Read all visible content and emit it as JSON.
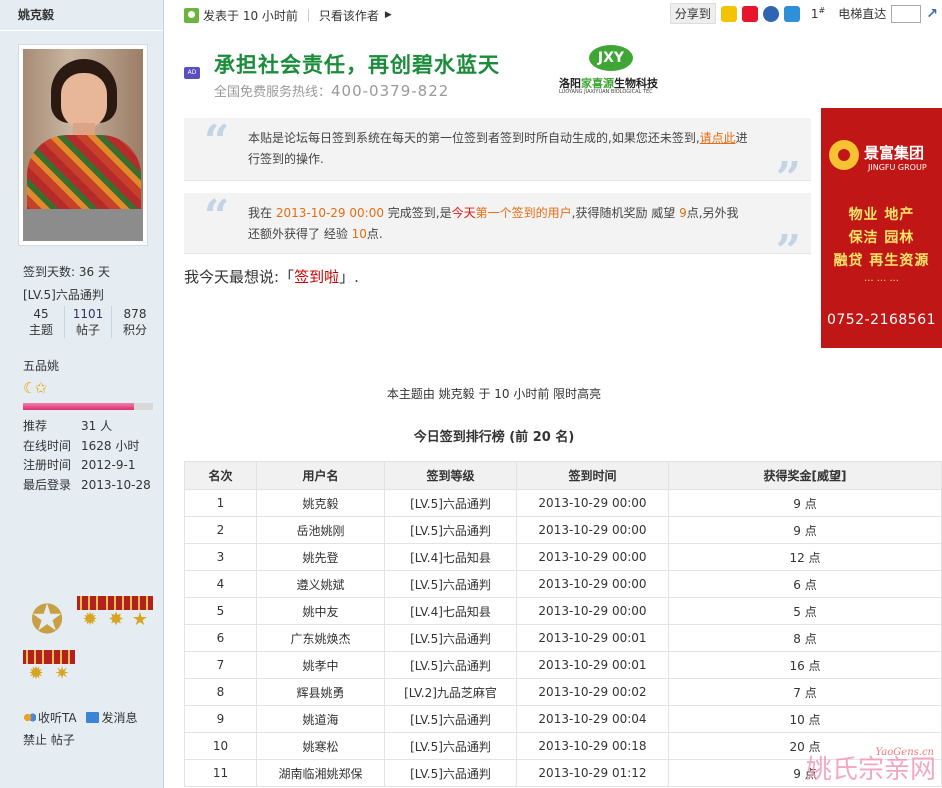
{
  "sidebar": {
    "username": "姚克毅",
    "signin_days": "签到天数: 36 天",
    "level": "[LV.5]六品通判",
    "counts": [
      {
        "num": "45",
        "label": "主题"
      },
      {
        "num": "1101",
        "label": "帖子"
      },
      {
        "num": "878",
        "label": "积分"
      }
    ],
    "rank_name": "五品姚",
    "rank_progress": 0.85,
    "info": [
      {
        "k": "推荐",
        "v": "31 人"
      },
      {
        "k": "在线时间",
        "v": "1628 小时"
      },
      {
        "k": "注册时间",
        "v": "2012-9-1"
      },
      {
        "k": "最后登录",
        "v": "2013-10-28"
      }
    ],
    "follow": "收听TA",
    "message": "发消息",
    "ban": "禁止",
    "posts": "帖子"
  },
  "postbar": {
    "posted": "发表于 10 小时前",
    "only_author": "只看该作者",
    "share_label": "分享到",
    "floor": "1",
    "floor_sup": "#",
    "jump_label": "电梯直达"
  },
  "ad_top": {
    "tag": "AD",
    "slogan": "承担社会责任，再创碧水蓝天",
    "hotline_label": "全国免费服务热线：",
    "hotline": "400-0379-822",
    "logo_mark": "JXY",
    "logo_cn_a": "洛阳",
    "logo_cn_b": "家喜源",
    "logo_cn_c": "生物科技",
    "logo_en": "LUOYANG JIAXIYUAN BIOLOGICAL TEC"
  },
  "quote1": {
    "t1": "本贴是论坛每日签到系统在每天的第一位签到者签到时所自动生成的,如果您还未签到,",
    "link": "请点此",
    "t2": "进行签到的操作."
  },
  "quote2": {
    "a": "我在 ",
    "time": "2013-10-29 00:00",
    "b": " 完成签到,是",
    "today": "今天",
    "first": "第一个签到的用户",
    "c": ",获得随机奖励 威望 ",
    "reward": "9",
    "d": "点,另外我还额外获得了 经验 ",
    "exp": "10",
    "e": "点."
  },
  "wish": {
    "label": "我今天最想说:「",
    "text": "签到啦",
    "end": "」."
  },
  "side_ad": {
    "name": "景富集团",
    "en": "JINGFU GROUP",
    "line1": "物业 地产",
    "line2": "保洁 园林",
    "line3": "融贷 再生资源",
    "dots": "··· ··· ···",
    "tel": "0752-2168561"
  },
  "highlight": "本主题由 姚克毅 于 10 小时前 限时高亮",
  "board": {
    "title": "今日签到排行榜 (前 20 名)",
    "headers": [
      "名次",
      "用户名",
      "签到等级",
      "签到时间",
      "获得奖金[威望]"
    ],
    "rows": [
      [
        "1",
        "姚克毅",
        "[LV.5]六品通判",
        "2013-10-29 00:00",
        "9 点"
      ],
      [
        "2",
        "岳池姚刚",
        "[LV.5]六品通判",
        "2013-10-29 00:00",
        "9 点"
      ],
      [
        "3",
        "姚先登",
        "[LV.4]七品知县",
        "2013-10-29 00:00",
        "12 点"
      ],
      [
        "4",
        "遵义姚斌",
        "[LV.5]六品通判",
        "2013-10-29 00:00",
        "6 点"
      ],
      [
        "5",
        "姚中友",
        "[LV.4]七品知县",
        "2013-10-29 00:00",
        "5 点"
      ],
      [
        "6",
        "广东姚焕杰",
        "[LV.5]六品通判",
        "2013-10-29 00:01",
        "8 点"
      ],
      [
        "7",
        "姚孝中",
        "[LV.5]六品通判",
        "2013-10-29 00:01",
        "16 点"
      ],
      [
        "8",
        "辉县姚勇",
        "[LV.2]九品芝麻官",
        "2013-10-29 00:02",
        "7 点"
      ],
      [
        "9",
        "姚道海",
        "[LV.5]六品通判",
        "2013-10-29 00:04",
        "10 点"
      ],
      [
        "10",
        "姚寒松",
        "[LV.5]六品通判",
        "2013-10-29 00:18",
        "20 点"
      ],
      [
        "11",
        "湖南临湘姚郑保",
        "[LV.5]六品通判",
        "2013-10-29 01:12",
        "9 点"
      ]
    ]
  },
  "watermark": {
    "cn": "姚氏宗亲网",
    "en": "YaoGens.cn"
  }
}
